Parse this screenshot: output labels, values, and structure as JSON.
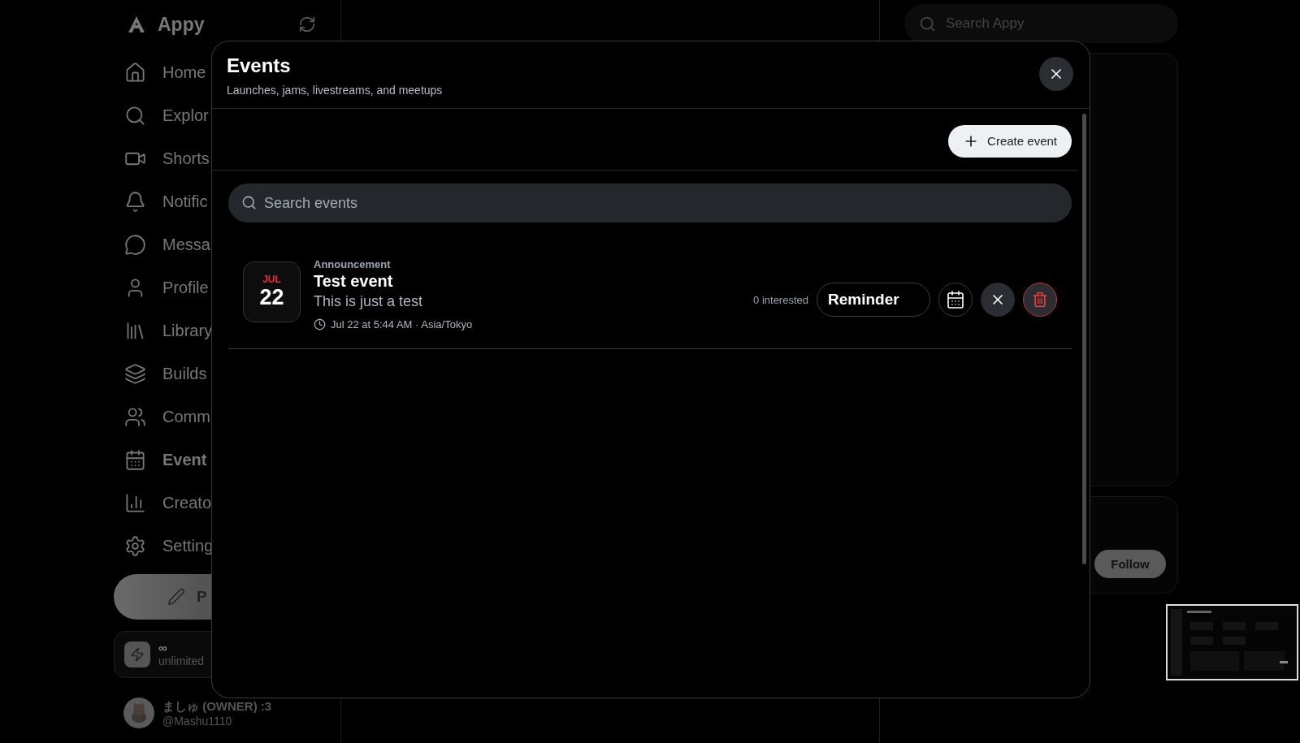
{
  "sidebar": {
    "logo": "Appy",
    "items": [
      {
        "kind": "home",
        "label": "Home",
        "selected": false
      },
      {
        "kind": "explore",
        "label": "Explor",
        "selected": false
      },
      {
        "kind": "video",
        "label": "Shorts",
        "selected": false
      },
      {
        "kind": "bell",
        "label": "Notific",
        "selected": false
      },
      {
        "kind": "chat",
        "label": "Messa",
        "selected": false
      },
      {
        "kind": "user",
        "label": "Profile",
        "selected": false
      },
      {
        "kind": "library",
        "label": "Library",
        "selected": false
      },
      {
        "kind": "layers",
        "label": "Builds",
        "selected": false
      },
      {
        "kind": "users",
        "label": "Comm",
        "selected": false
      },
      {
        "kind": "calendar",
        "label": "Event",
        "selected": true
      },
      {
        "kind": "chart",
        "label": "Creato",
        "selected": false
      },
      {
        "kind": "settings",
        "label": "Setting",
        "selected": false
      }
    ],
    "post_button": "P",
    "plan": {
      "title": "∞",
      "subtitle": "unlimited"
    },
    "user": {
      "name": "ましゅ (OWNER) :3",
      "handle": "@Mashu1110"
    }
  },
  "search": {
    "placeholder": "Search Appy"
  },
  "follow_button": "Follow",
  "modal": {
    "title": "Events",
    "subtitle": "Launches, jams, livestreams, and meetups",
    "create_button": "Create event",
    "search": {
      "placeholder": "Search events"
    },
    "events": [
      {
        "month": "JUL",
        "day": "22",
        "category": "Announcement",
        "title": "Test event",
        "description": "This is just a test",
        "time": "Jul 22 at 5:44 AM · Asia/Tokyo",
        "interested": "0 interested",
        "reminder": "Reminder"
      }
    ]
  }
}
